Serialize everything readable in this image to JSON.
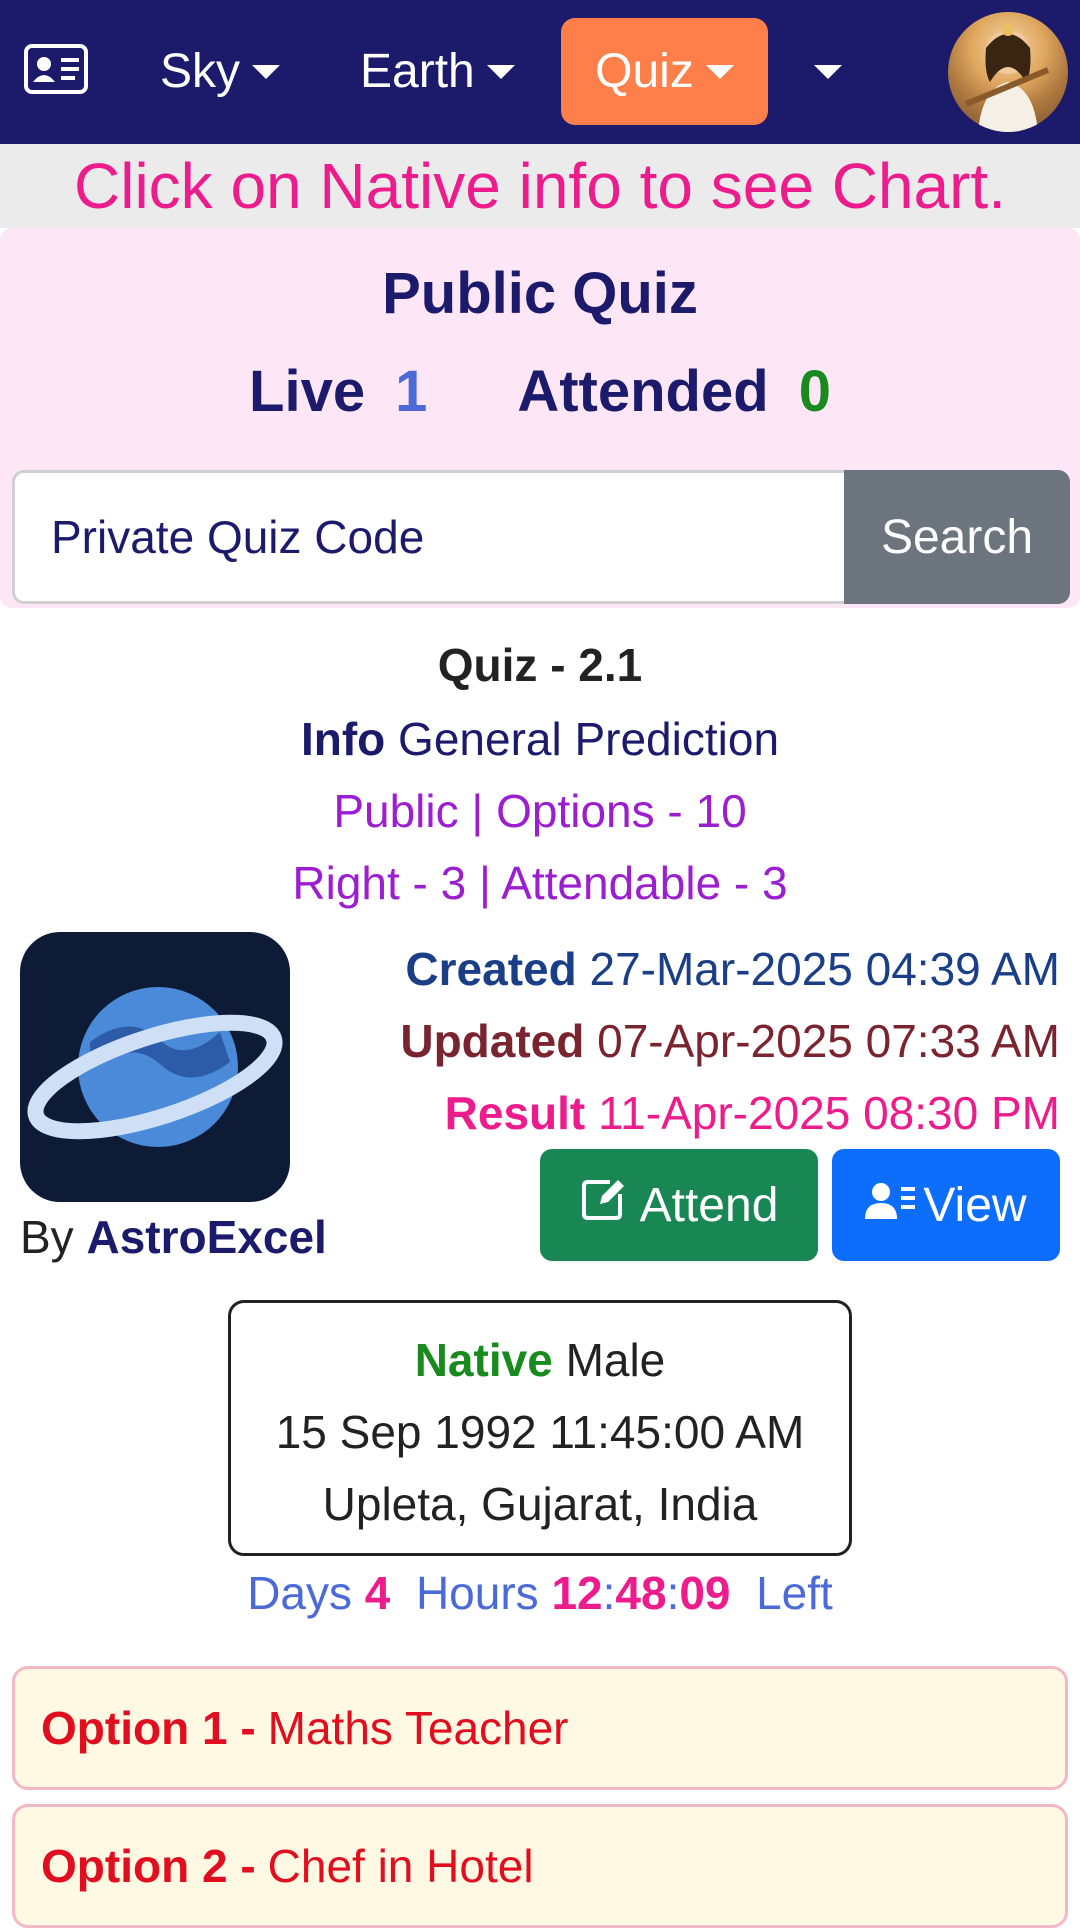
{
  "nav": {
    "sky_label": "Sky",
    "earth_label": "Earth",
    "quiz_label": "Quiz",
    "active_color": "#ff7f4a",
    "bar_color": "#1b1a6b"
  },
  "hint": "Click on Native info to see Chart.",
  "public_quiz": {
    "title": "Public Quiz",
    "live_label": "Live",
    "live_count": "1",
    "attended_label": "Attended",
    "attended_count": "0"
  },
  "search": {
    "placeholder": "Private Quiz Code",
    "button_label": "Search"
  },
  "quiz": {
    "name": "Quiz - 2.1",
    "info_label": "Info",
    "info_value": "General Prediction",
    "visibility_line": "Public | Options - 10",
    "right_line": "Right - 3 | Attendable - 3",
    "by_label": "By",
    "author": "AstroExcel",
    "created_label": "Created",
    "created_value": "27-Mar-2025 04:39 AM",
    "updated_label": "Updated",
    "updated_value": "07-Apr-2025 07:33 AM",
    "result_label": "Result",
    "result_value": "11-Apr-2025 08:30 PM",
    "attend_label": "Attend",
    "view_label": "View"
  },
  "native": {
    "label": "Native",
    "gender": "Male",
    "birth_datetime": "15 Sep 1992 11:45:00 AM",
    "place": "Upleta, Gujarat, India"
  },
  "countdown": {
    "days_label": "Days",
    "days": "4",
    "hours_label": "Hours",
    "hh": "12",
    "mm": "48",
    "ss": "09",
    "left_label": "Left"
  },
  "options": [
    {
      "prefix": "Option 1 -",
      "text": "Maths Teacher"
    },
    {
      "prefix": "Option 2 -",
      "text": "Chef in Hotel"
    }
  ],
  "icons": {
    "card": "id-card-icon",
    "avatar": "avatar",
    "logo": "planet-icon",
    "attend": "edit-icon",
    "view": "user-list-icon"
  }
}
